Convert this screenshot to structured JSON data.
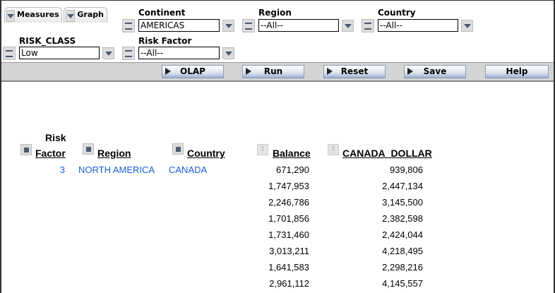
{
  "tabs": [
    {
      "label": "Measures"
    },
    {
      "label": "Graph"
    }
  ],
  "filters": {
    "continent": {
      "label": "Continent",
      "value": "AMERICAS"
    },
    "region": {
      "label": "Region",
      "value": "--All--"
    },
    "country": {
      "label": "Country",
      "value": "--All--"
    },
    "risk_class": {
      "label": "RISK_CLASS",
      "value": "Low"
    },
    "risk_factor": {
      "label": "Risk Factor",
      "value": "--All--"
    }
  },
  "toolbar": {
    "olap": "OLAP",
    "run": "Run",
    "reset": "Reset",
    "save": "Save",
    "help": "Help"
  },
  "table": {
    "headers": {
      "risk_line1": "Risk",
      "risk_line2": "Factor",
      "region": "Region",
      "country": "Country",
      "balance": "Balance",
      "cad": "CANADA_DOLLAR"
    },
    "first": {
      "risk_factor": "3",
      "region": "NORTH AMERICA",
      "country": "CANADA"
    },
    "rows": [
      {
        "balance": "671,290",
        "cad": "939,806"
      },
      {
        "balance": "1,747,953",
        "cad": "2,447,134"
      },
      {
        "balance": "2,246,786",
        "cad": "3,145,500"
      },
      {
        "balance": "1,701,856",
        "cad": "2,382,598"
      },
      {
        "balance": "1,731,460",
        "cad": "2,424,044"
      },
      {
        "balance": "3,013,211",
        "cad": "4,218,495"
      },
      {
        "balance": "1,641,583",
        "cad": "2,298,216"
      },
      {
        "balance": "2,961,112",
        "cad": "4,145,557"
      }
    ]
  }
}
